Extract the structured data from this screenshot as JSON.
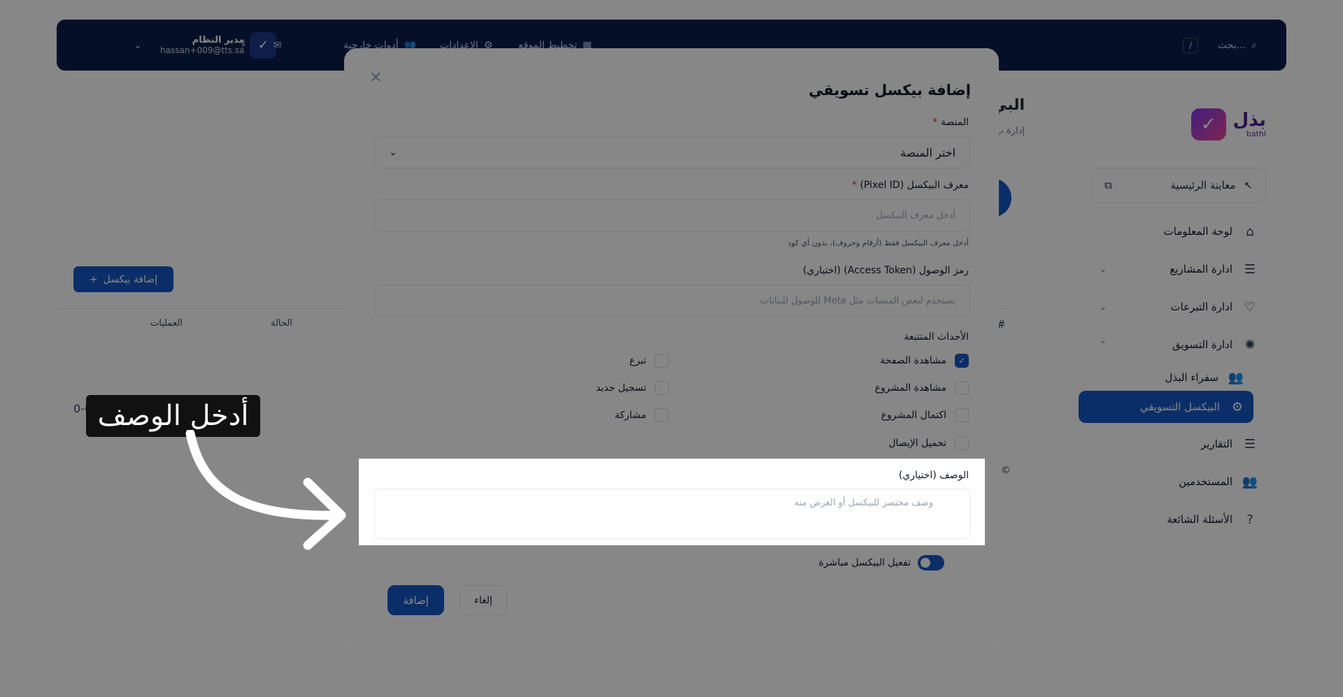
{
  "topbar": {
    "search_placeholder": "بحث...",
    "search_shortcut": "/",
    "nav_site_plan": "تخطيط الموقع",
    "nav_settings": "الإعدادات",
    "nav_external_tools": "أدوات خارجية",
    "user_name": "مدير النظام",
    "user_email": "hassan+009@tts.sa"
  },
  "sidebar": {
    "logo_ar": "بذل",
    "logo_en": "bathl",
    "preview_label": "معاينة الرئيسية",
    "items": [
      {
        "label": "لوحة المعلومات"
      },
      {
        "label": "ادارة المشاريع"
      },
      {
        "label": "ادارة التبرعات"
      },
      {
        "label": "ادارة التسويق"
      },
      {
        "label": "سفراء البذل"
      },
      {
        "label": "البيكسل التسويقي"
      },
      {
        "label": "التقارير"
      },
      {
        "label": "المستخدمين"
      },
      {
        "label": "الأسئلة الشائعة"
      }
    ]
  },
  "page": {
    "title": "البي",
    "subtitle": "إدارة ب",
    "add_pixel_button": "إضافة بيكسل",
    "col_operations": "العمليات",
    "col_status": "الحالة",
    "col_hash": "#",
    "footer_year": "026 ©",
    "pagination_text": "0-0 10"
  },
  "modal": {
    "title": "إضافة بيكسل تسويقي",
    "platform_label": "المنصة",
    "platform_value": "اختر المنصة",
    "pixel_id_label": "معرف البيكسل (Pixel ID)",
    "pixel_id_placeholder": "أدخل معرف البيكسل",
    "pixel_id_help": "أدخل معرف البيكسل فقط (أرقام وحروف)، بدون أي كود",
    "access_token_label": "رمز الوصول (Access Token) (اختياري)",
    "access_token_placeholder": "يستخدم لبعض المنصات مثل Meta للوصول للبيانات",
    "events_label": "الأحداث المتتبعة",
    "events": [
      {
        "label": "مشاهدة الصفحة",
        "checked": true
      },
      {
        "label": "تبرع",
        "checked": false
      },
      {
        "label": "مشاهدة المشروع",
        "checked": false
      },
      {
        "label": "تسجيل جديد",
        "checked": false
      },
      {
        "label": "اكتمال المشروع",
        "checked": false
      },
      {
        "label": "مشاركة",
        "checked": false
      },
      {
        "label": "تحميل الإيصال",
        "checked": false
      }
    ],
    "description_label": "الوصف (اختياري)",
    "description_placeholder": "وصف مختصر للبيكسل أو الغرض منه",
    "activate_label": "تفعيل البيكسل مباشرة",
    "activate_on": true,
    "add_button": "إضافة",
    "cancel_button": "إلغاء"
  },
  "callout": {
    "text": "أدخل الوصف"
  },
  "colors": {
    "primary": "#1557c7",
    "topbar": "#0b1f4d",
    "required": "#dc2626"
  }
}
